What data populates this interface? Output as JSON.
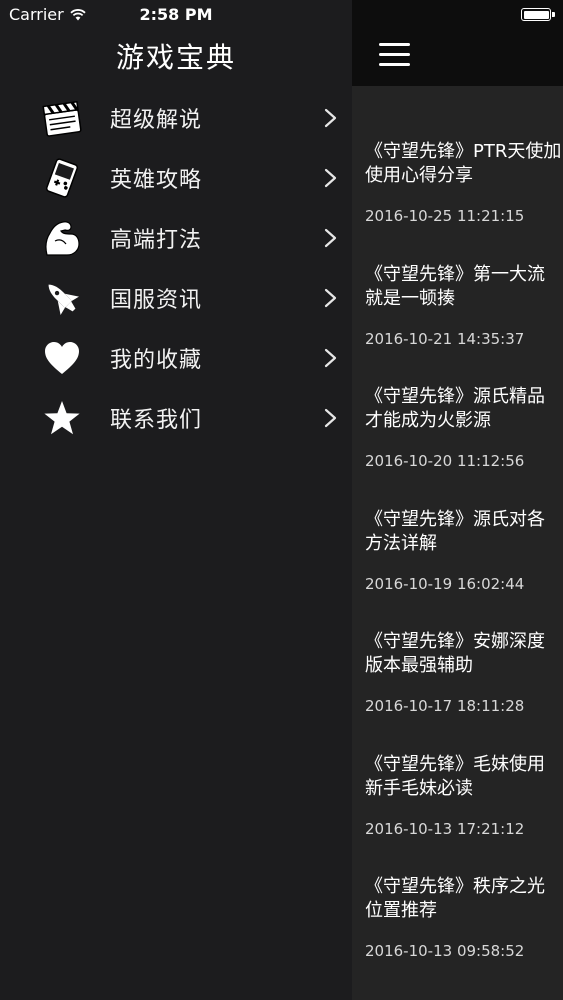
{
  "status_bar": {
    "carrier": "Carrier",
    "time": "2:58 PM"
  },
  "drawer": {
    "title": "游戏宝典",
    "items": [
      {
        "label": "超级解说",
        "icon": "clapperboard-icon"
      },
      {
        "label": "英雄攻略",
        "icon": "gameboy-icon"
      },
      {
        "label": "高端打法",
        "icon": "flexed-arm-icon"
      },
      {
        "label": "国服资讯",
        "icon": "space-shuttle-icon"
      },
      {
        "label": "我的收藏",
        "icon": "heart-icon"
      },
      {
        "label": "联系我们",
        "icon": "star-icon"
      }
    ]
  },
  "articles": [
    {
      "title": "《守望先锋》PTR天使加\n使用心得分享",
      "date": "2016-10-25 11:21:15"
    },
    {
      "title": "《守望先锋》第一大流\n就是一顿揍",
      "date": "2016-10-21 14:35:37"
    },
    {
      "title": "《守望先锋》源氏精品\n才能成为火影源",
      "date": "2016-10-20 11:12:56"
    },
    {
      "title": "《守望先锋》源氏对各\n方法详解",
      "date": "2016-10-19 16:02:44"
    },
    {
      "title": "《守望先锋》安娜深度\n版本最强辅助",
      "date": "2016-10-17 18:11:28"
    },
    {
      "title": "《守望先锋》毛妹使用\n新手毛妹必读",
      "date": "2016-10-13 17:21:12"
    },
    {
      "title": "《守望先锋》秩序之光\n位置推荐",
      "date": "2016-10-13 09:58:52"
    }
  ]
}
